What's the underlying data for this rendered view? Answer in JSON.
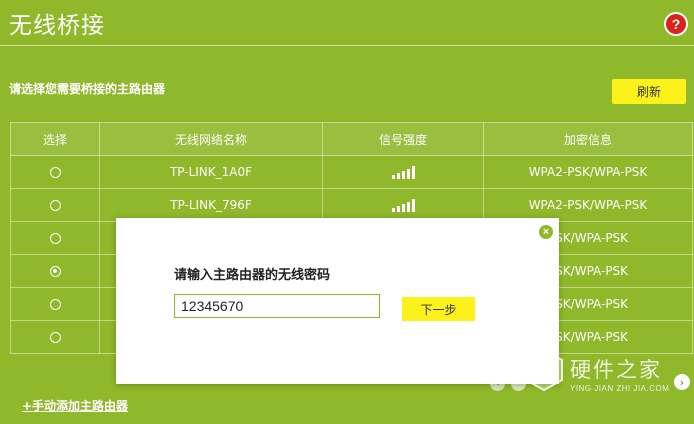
{
  "header": {
    "title": "无线桥接",
    "help_glyph": "?"
  },
  "prompt": "请选择您需要桥接的主路由器",
  "refresh_label": "刷新",
  "table": {
    "columns": [
      "选择",
      "无线网络名称",
      "信号强度",
      "加密信息"
    ],
    "rows": [
      {
        "ssid": "TP-LINK_1A0F",
        "security": "WPA2-PSK/WPA-PSK",
        "selected": false
      },
      {
        "ssid": "TP-LINK_796F",
        "security": "WPA2-PSK/WPA-PSK",
        "selected": false
      },
      {
        "ssid": "",
        "security": "PSK/WPA-PSK",
        "selected": false
      },
      {
        "ssid": "",
        "security": "PSK/WPA-PSK",
        "selected": true
      },
      {
        "ssid": "",
        "security": "PSK/WPA-PSK",
        "selected": false
      },
      {
        "ssid": "",
        "security": "PSK/WPA-PSK",
        "selected": false
      }
    ]
  },
  "add_link": "+手动添加主路由器",
  "modal": {
    "label": "请输入主路由器的无线密码",
    "password_value": "12345670",
    "next_label": "下一步"
  },
  "watermark": {
    "text": "硬件之家",
    "sub": "YING JIAN ZHI JIA.COM"
  },
  "colors": {
    "background": "#8fb82a",
    "accent_button": "#fcf11a",
    "help_icon": "#d9231d"
  }
}
